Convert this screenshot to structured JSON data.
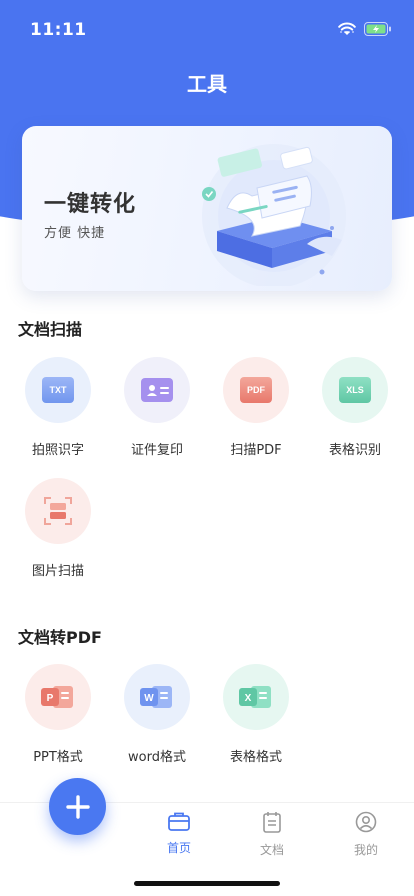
{
  "status_bar": {
    "time": "11:11"
  },
  "header": {
    "title": "工具"
  },
  "banner": {
    "title": "一键转化",
    "subtitle": "方便 快捷"
  },
  "sections": {
    "scan": {
      "title": "文档扫描",
      "tools": [
        {
          "label": "拍照识字",
          "icon_text": "TXT",
          "icon": "txt-icon"
        },
        {
          "label": "证件复印",
          "icon": "id-card-icon"
        },
        {
          "label": "扫描PDF",
          "icon_text": "PDF",
          "icon": "pdf-icon"
        },
        {
          "label": "表格识别",
          "icon_text": "XLS",
          "icon": "xls-icon"
        },
        {
          "label": "图片扫描",
          "icon": "image-scan-icon"
        }
      ]
    },
    "convert": {
      "title": "文档转PDF",
      "tools": [
        {
          "label": "PPT格式",
          "icon_text": "P",
          "icon": "ppt-icon"
        },
        {
          "label": "word格式",
          "icon_text": "W",
          "icon": "word-icon"
        },
        {
          "label": "表格格式",
          "icon_text": "X",
          "icon": "excel-icon"
        }
      ]
    }
  },
  "tabbar": {
    "tabs": [
      {
        "label": "首页",
        "icon": "briefcase-icon",
        "active": true
      },
      {
        "label": "文档",
        "icon": "document-icon",
        "active": false
      },
      {
        "label": "我的",
        "icon": "user-icon",
        "active": false
      }
    ],
    "fab_icon": "plus-icon"
  },
  "colors": {
    "primary": "#4a74f0",
    "active_tab": "#4a78f1",
    "inactive_tab": "#999999"
  }
}
